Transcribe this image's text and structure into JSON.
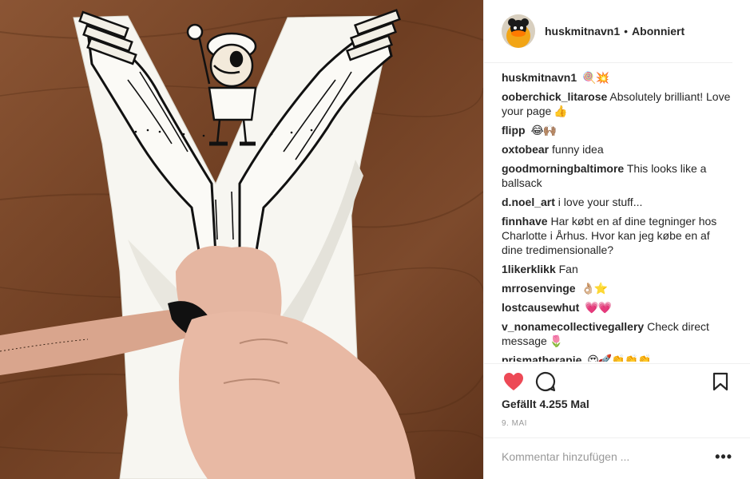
{
  "post": {
    "username": "huskmitnavn1",
    "separator": "•",
    "follow_status": "Abonniert",
    "avatar_icon": "duck-avatar-icon",
    "comments": [
      {
        "user": "huskmitnavn1",
        "text": "",
        "emoji": "🍭💥"
      },
      {
        "user": "ooberchick_litarose",
        "text": "Absolutely brilliant! Love your page",
        "emoji": "👍"
      },
      {
        "user": "flipp",
        "text": "",
        "emoji": "😂🙌🏽"
      },
      {
        "user": "oxtobear",
        "text": "funny idea",
        "emoji": ""
      },
      {
        "user": "goodmorningbaltimore",
        "text": "This looks like a ballsack",
        "emoji": ""
      },
      {
        "user": "d.noel_art",
        "text": "i love your stuff...",
        "emoji": ""
      },
      {
        "user": "finnhave",
        "text": "Har købt en af dine tegninger hos Charlotte i Århus. Hvor kan jeg købe en af dine tredimensionalle?",
        "emoji": ""
      },
      {
        "user": "1likerklikk",
        "text": "Fan",
        "emoji": ""
      },
      {
        "user": "mrrosenvinge",
        "text": "",
        "emoji": "👌🏼⭐"
      },
      {
        "user": "lostcausewhut",
        "text": "",
        "emoji": "💗💗"
      },
      {
        "user": "v_nonamecollectivegallery",
        "text": "Check direct message",
        "emoji": "🌷"
      },
      {
        "user": "prismatherapie",
        "text": "",
        "emoji": "😍🚀👏👏👏"
      }
    ],
    "likes_text": "Gefällt 4.255 Mal",
    "date": "9. MAI",
    "comment_placeholder": "Kommentar hinzufügen ...",
    "more_label": "•••",
    "icons": {
      "like": "heart-icon",
      "comment": "speech-bubble-icon",
      "save": "bookmark-icon"
    },
    "colors": {
      "like_red": "#ed4956",
      "text": "#262626",
      "muted": "#999999"
    }
  }
}
